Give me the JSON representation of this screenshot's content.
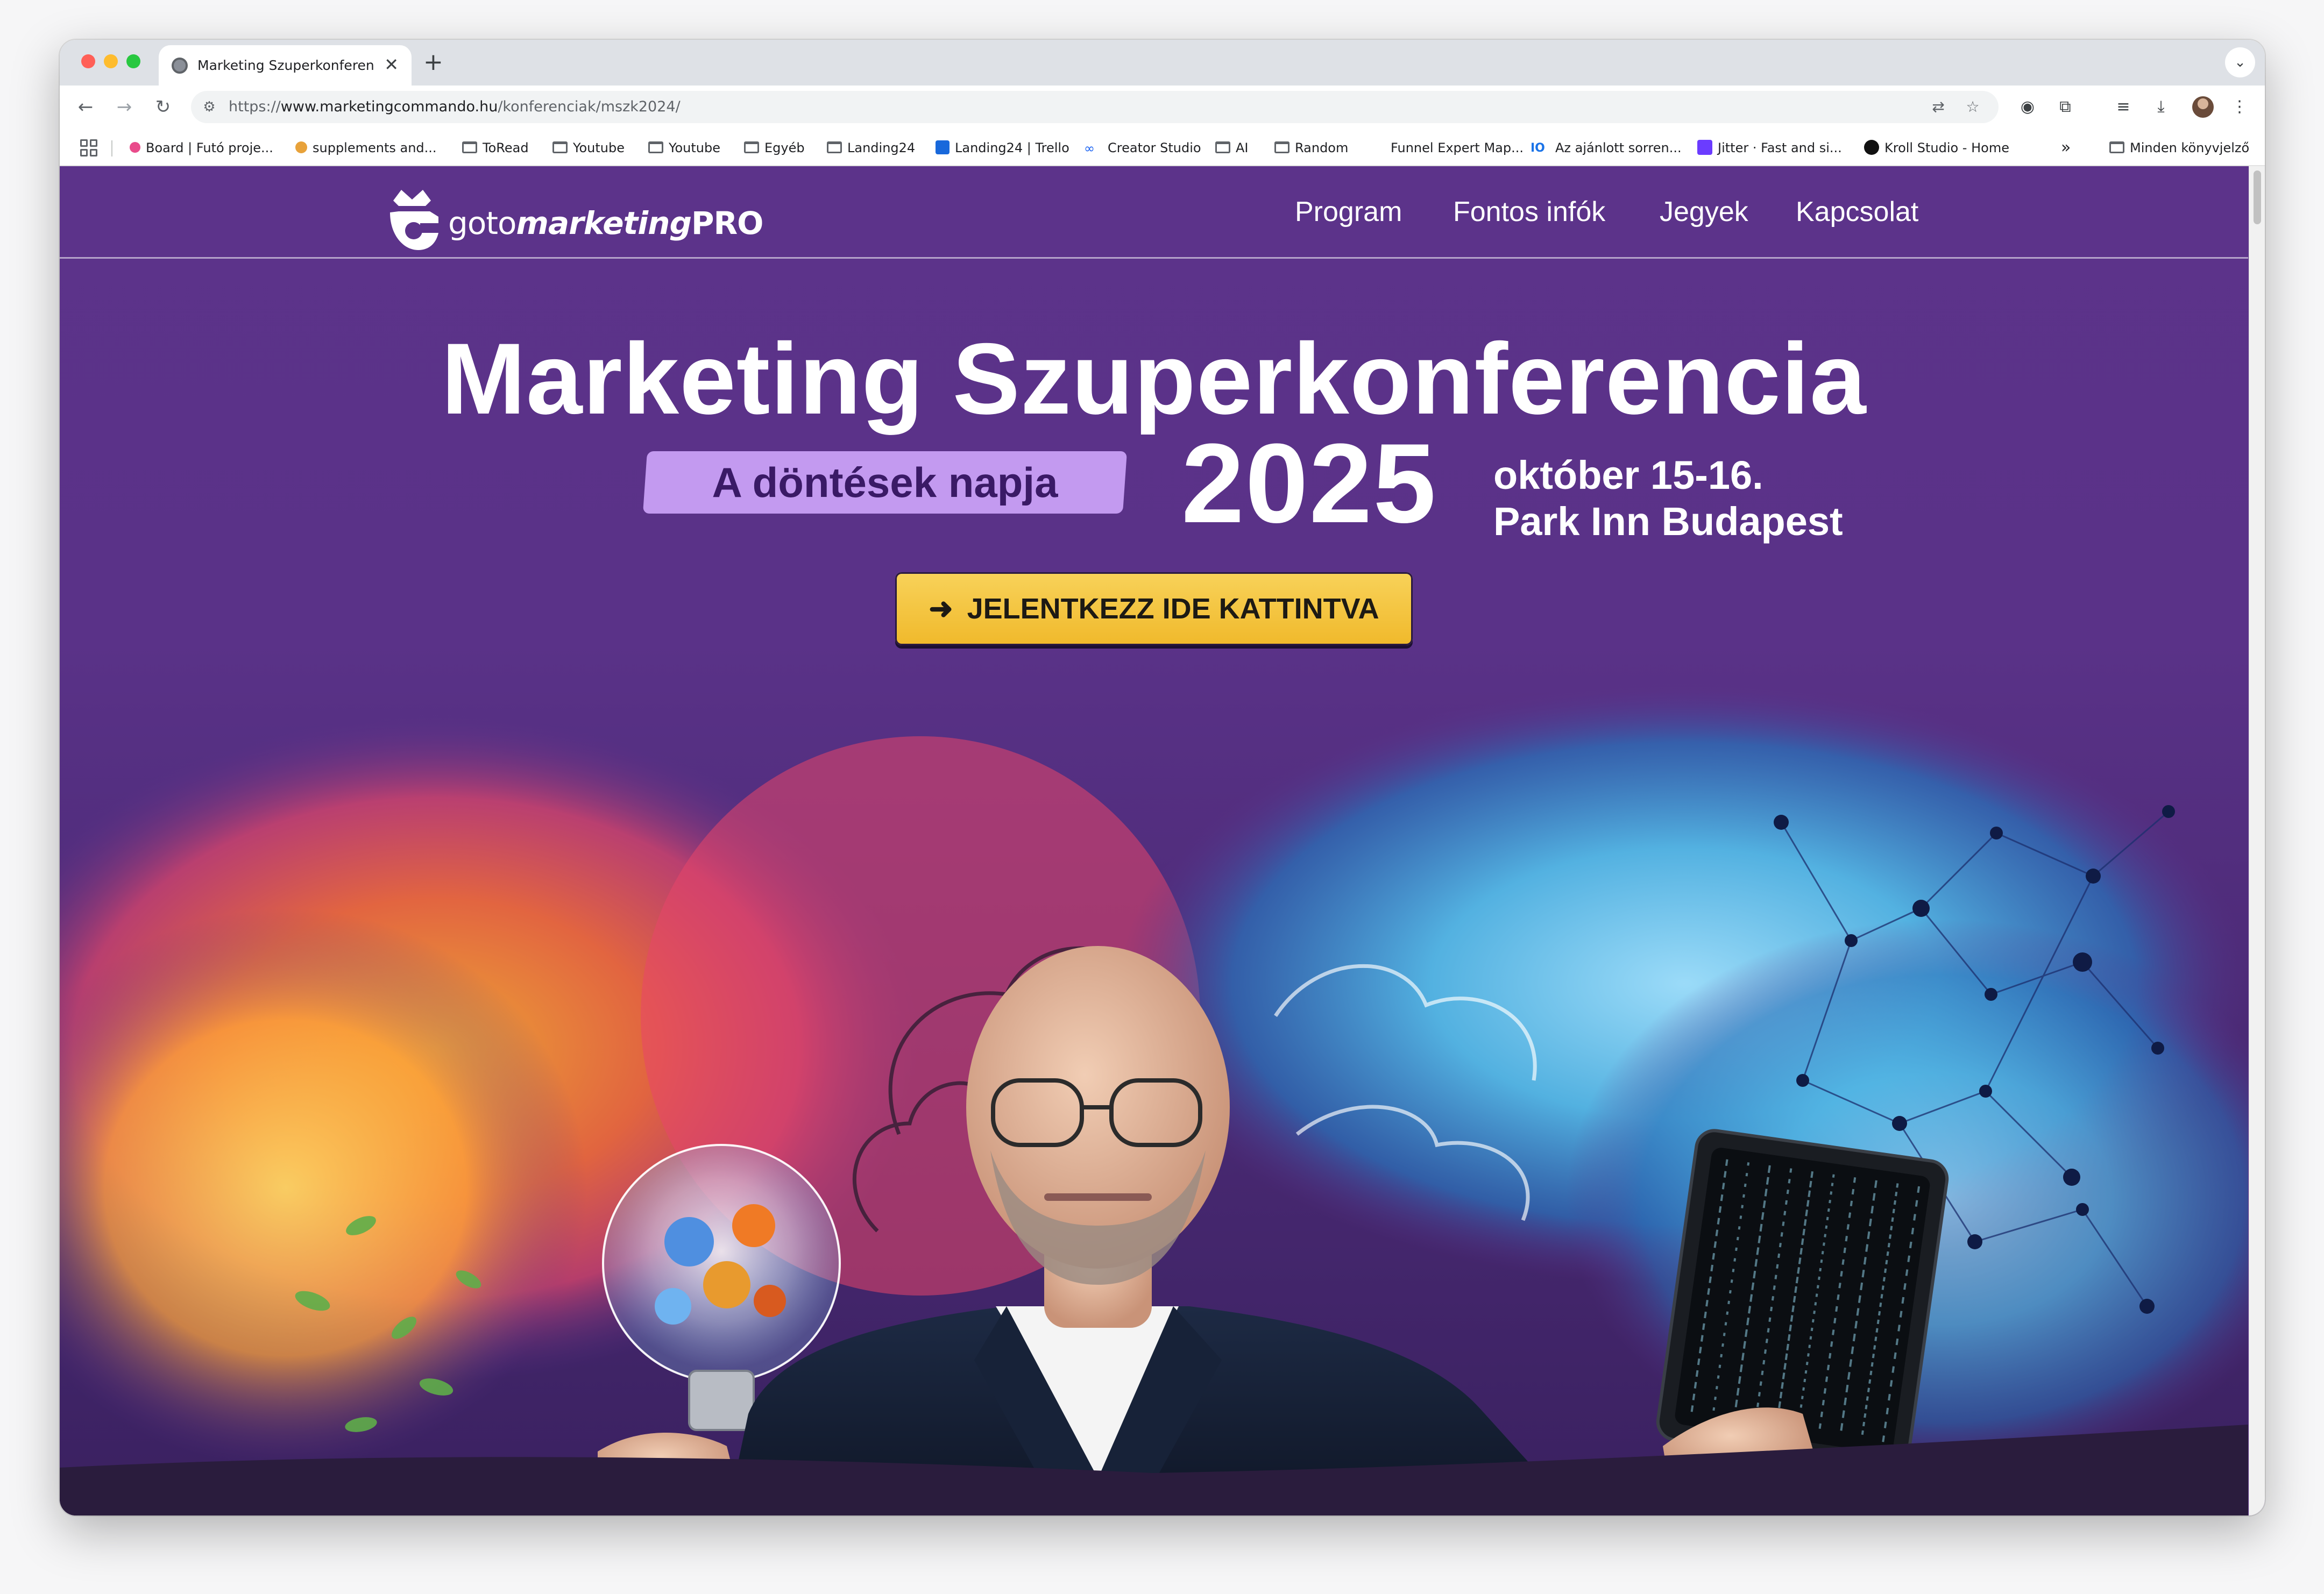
{
  "browser": {
    "tab": {
      "title": "Marketing Szuperkonferencia",
      "close_glyph": "✕"
    },
    "new_tab_glyph": "+",
    "tabs_menu_glyph": "⌄",
    "nav": {
      "back": "←",
      "forward": "→",
      "reload": "↻"
    },
    "url": {
      "scheme": "https://",
      "host": "www.marketingcommando.hu",
      "path": "/konferenciak/mszk2024/"
    },
    "omnibox_icons": [
      "translate-icon",
      "star-icon"
    ],
    "toolbar_icons": [
      "screenshot-icon",
      "extensions-icon",
      "reading-list-icon",
      "download-icon",
      "profile-avatar",
      "menu-icon"
    ],
    "bookmarks": [
      {
        "label": "Board | Futó proje...",
        "icon": "colored-logo-icon",
        "color": "#e94b8b"
      },
      {
        "label": "supplements and...",
        "icon": "pill-icon",
        "color": "#e8a23a"
      },
      {
        "label": "ToRead",
        "icon": "folder-icon"
      },
      {
        "label": "Youtube",
        "icon": "folder-icon"
      },
      {
        "label": "Youtube",
        "icon": "folder-icon"
      },
      {
        "label": "Egyéb",
        "icon": "folder-icon"
      },
      {
        "label": "Landing24",
        "icon": "folder-icon"
      },
      {
        "label": "Landing24 | Trello",
        "icon": "trello-icon",
        "color": "#1868db"
      },
      {
        "label": "Creator Studio",
        "icon": "meta-icon",
        "color": "#1c64f2"
      },
      {
        "label": "AI",
        "icon": "folder-icon"
      },
      {
        "label": "Random",
        "icon": "folder-icon"
      },
      {
        "label": "Funnel Expert Map...",
        "icon": "blank-icon"
      },
      {
        "label": "Az ajánlott sorren...",
        "icon": "io-icon",
        "color": "#1a73e8"
      },
      {
        "label": "Jitter · Fast and si...",
        "icon": "jitter-icon",
        "color": "#6b3cff"
      },
      {
        "label": "Kroll Studio - Home",
        "icon": "dot-icon",
        "color": "#111111"
      }
    ],
    "bookmarks_overflow": "»",
    "all_bookmarks": "Minden könyvjelző"
  },
  "page": {
    "logo": {
      "part1": "goto",
      "part2": "marketing",
      "part3": "PRO"
    },
    "nav": [
      "Program",
      "Fontos infók",
      "Jegyek",
      "Kapcsolat"
    ],
    "title": "Marketing Szuperkonferencia",
    "tagline": "A döntések napja",
    "year": "2025",
    "date": "október 15-16.",
    "venue": "Park Inn Budapest",
    "cta": {
      "arrow": "➜",
      "label": "JELENTKEZZ IDE KATTINTVA"
    },
    "colors": {
      "background": "#5c338a",
      "pill": "#c39af0",
      "cta": "#f0b92b"
    }
  }
}
